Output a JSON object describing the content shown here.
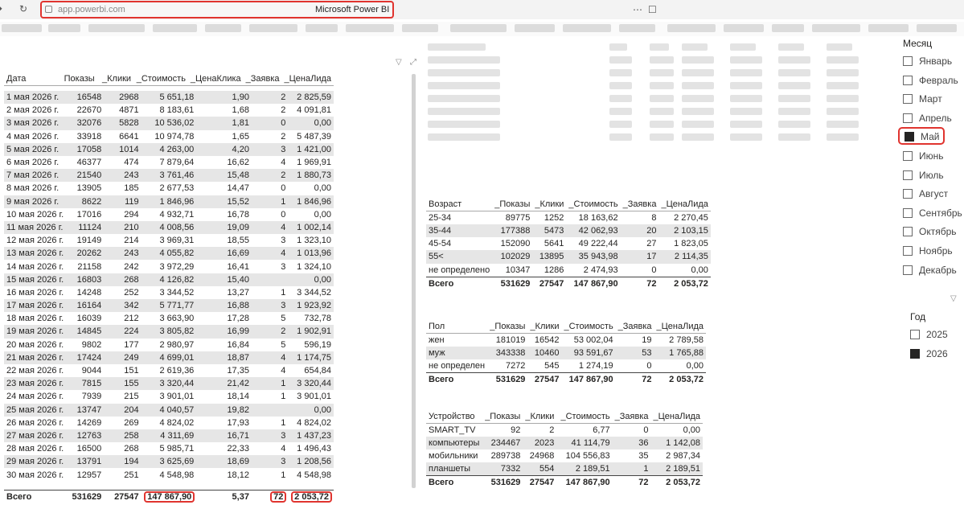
{
  "browser": {
    "url": "app.powerbi.com",
    "title": "Microsoft Power BI"
  },
  "main_table": {
    "headers": [
      "Дата",
      "Показы",
      "_Клики",
      "_Стоимость",
      "_ЦенаКлика",
      "_Заявка",
      "_ЦенаЛида"
    ],
    "rows": [
      [
        "1 мая 2026 г.",
        "16548",
        "2968",
        "5 651,18",
        "1,90",
        "2",
        "2 825,59"
      ],
      [
        "2 мая 2026 г.",
        "22670",
        "4871",
        "8 183,61",
        "1,68",
        "2",
        "4 091,81"
      ],
      [
        "3 мая 2026 г.",
        "32076",
        "5828",
        "10 536,02",
        "1,81",
        "0",
        "0,00"
      ],
      [
        "4 мая 2026 г.",
        "33918",
        "6641",
        "10 974,78",
        "1,65",
        "2",
        "5 487,39"
      ],
      [
        "5 мая 2026 г.",
        "17058",
        "1014",
        "4 263,00",
        "4,20",
        "3",
        "1 421,00"
      ],
      [
        "6 мая 2026 г.",
        "46377",
        "474",
        "7 879,64",
        "16,62",
        "4",
        "1 969,91"
      ],
      [
        "7 мая 2026 г.",
        "21540",
        "243",
        "3 761,46",
        "15,48",
        "2",
        "1 880,73"
      ],
      [
        "8 мая 2026 г.",
        "13905",
        "185",
        "2 677,53",
        "14,47",
        "0",
        "0,00"
      ],
      [
        "9 мая 2026 г.",
        "8622",
        "119",
        "1 846,96",
        "15,52",
        "1",
        "1 846,96"
      ],
      [
        "10 мая 2026 г.",
        "17016",
        "294",
        "4 932,71",
        "16,78",
        "0",
        "0,00"
      ],
      [
        "11 мая 2026 г.",
        "11124",
        "210",
        "4 008,56",
        "19,09",
        "4",
        "1 002,14"
      ],
      [
        "12 мая 2026 г.",
        "19149",
        "214",
        "3 969,31",
        "18,55",
        "3",
        "1 323,10"
      ],
      [
        "13 мая 2026 г.",
        "20262",
        "243",
        "4 055,82",
        "16,69",
        "4",
        "1 013,96"
      ],
      [
        "14 мая 2026 г.",
        "21158",
        "242",
        "3 972,29",
        "16,41",
        "3",
        "1 324,10"
      ],
      [
        "15 мая 2026 г.",
        "16803",
        "268",
        "4 126,82",
        "15,40",
        "",
        "0,00"
      ],
      [
        "16 мая 2026 г.",
        "14248",
        "252",
        "3 344,52",
        "13,27",
        "1",
        "3 344,52"
      ],
      [
        "17 мая 2026 г.",
        "16164",
        "342",
        "5 771,77",
        "16,88",
        "3",
        "1 923,92"
      ],
      [
        "18 мая 2026 г.",
        "16039",
        "212",
        "3 663,90",
        "17,28",
        "5",
        "732,78"
      ],
      [
        "19 мая 2026 г.",
        "14845",
        "224",
        "3 805,82",
        "16,99",
        "2",
        "1 902,91"
      ],
      [
        "20 мая 2026 г.",
        "9802",
        "177",
        "2 980,97",
        "16,84",
        "5",
        "596,19"
      ],
      [
        "21 мая 2026 г.",
        "17424",
        "249",
        "4 699,01",
        "18,87",
        "4",
        "1 174,75"
      ],
      [
        "22 мая 2026 г.",
        "9044",
        "151",
        "2 619,36",
        "17,35",
        "4",
        "654,84"
      ],
      [
        "23 мая 2026 г.",
        "7815",
        "155",
        "3 320,44",
        "21,42",
        "1",
        "3 320,44"
      ],
      [
        "24 мая 2026 г.",
        "7939",
        "215",
        "3 901,01",
        "18,14",
        "1",
        "3 901,01"
      ],
      [
        "25 мая 2026 г.",
        "13747",
        "204",
        "4 040,57",
        "19,82",
        "",
        "0,00"
      ],
      [
        "26 мая 2026 г.",
        "14269",
        "269",
        "4 824,02",
        "17,93",
        "1",
        "4 824,02"
      ],
      [
        "27 мая 2026 г.",
        "12763",
        "258",
        "4 311,69",
        "16,71",
        "3",
        "1 437,23"
      ],
      [
        "28 мая 2026 г.",
        "16500",
        "268",
        "5 985,71",
        "22,33",
        "4",
        "1 496,43"
      ],
      [
        "29 мая 2026 г.",
        "13791",
        "194",
        "3 625,69",
        "18,69",
        "3",
        "1 208,56"
      ],
      [
        "30 мая 2026 г.",
        "12957",
        "251",
        "4 548,98",
        "18,12",
        "1",
        "4 548,98"
      ]
    ],
    "total": [
      "Всего",
      "531629",
      "27547",
      "147 867,90",
      "5,37",
      "72",
      "2 053,72"
    ]
  },
  "age_table": {
    "headers": [
      "Возраст",
      "_Показы",
      "_Клики",
      "_Стоимость",
      "_Заявка",
      "_ЦенаЛида"
    ],
    "rows": [
      [
        "25-34",
        "89775",
        "1252",
        "18 163,62",
        "8",
        "2 270,45"
      ],
      [
        "35-44",
        "177388",
        "5473",
        "42 062,93",
        "20",
        "2 103,15"
      ],
      [
        "45-54",
        "152090",
        "5641",
        "49 222,44",
        "27",
        "1 823,05"
      ],
      [
        "55<",
        "102029",
        "13895",
        "35 943,98",
        "17",
        "2 114,35"
      ],
      [
        "не определено",
        "10347",
        "1286",
        "2 474,93",
        "0",
        "0,00"
      ]
    ],
    "total": [
      "Всего",
      "531629",
      "27547",
      "147 867,90",
      "72",
      "2 053,72"
    ]
  },
  "gender_table": {
    "headers": [
      "Пол",
      "_Показы",
      "_Клики",
      "_Стоимость",
      "_Заявка",
      "_ЦенаЛида"
    ],
    "rows": [
      [
        "жен",
        "181019",
        "16542",
        "53 002,04",
        "19",
        "2 789,58"
      ],
      [
        "муж",
        "343338",
        "10460",
        "93 591,67",
        "53",
        "1 765,88"
      ],
      [
        "не определен",
        "7272",
        "545",
        "1 274,19",
        "0",
        "0,00"
      ]
    ],
    "total": [
      "Всего",
      "531629",
      "27547",
      "147 867,90",
      "72",
      "2 053,72"
    ]
  },
  "device_table": {
    "headers": [
      "Устройство",
      "_Показы",
      "_Клики",
      "_Стоимость",
      "_Заявка",
      "_ЦенаЛида"
    ],
    "rows": [
      [
        "SMART_TV",
        "92",
        "2",
        "6,77",
        "0",
        "0,00"
      ],
      [
        "компьютеры",
        "234467",
        "2023",
        "41 114,79",
        "36",
        "1 142,08"
      ],
      [
        "мобильники",
        "289738",
        "24968",
        "104 556,83",
        "35",
        "2 987,34"
      ],
      [
        "планшеты",
        "7332",
        "554",
        "2 189,51",
        "1",
        "2 189,51"
      ]
    ],
    "total": [
      "Всего",
      "531629",
      "27547",
      "147 867,90",
      "72",
      "2 053,72"
    ]
  },
  "month_slicer": {
    "title": "Месяц",
    "items": [
      "Январь",
      "Февраль",
      "Март",
      "Апрель",
      "Май",
      "Июнь",
      "Июль",
      "Август",
      "Сентябрь",
      "Октябрь",
      "Ноябрь",
      "Декабрь"
    ],
    "selected": "Май"
  },
  "year_slicer": {
    "title": "Год",
    "items": [
      "2025",
      "2026"
    ],
    "selected": "2026"
  }
}
